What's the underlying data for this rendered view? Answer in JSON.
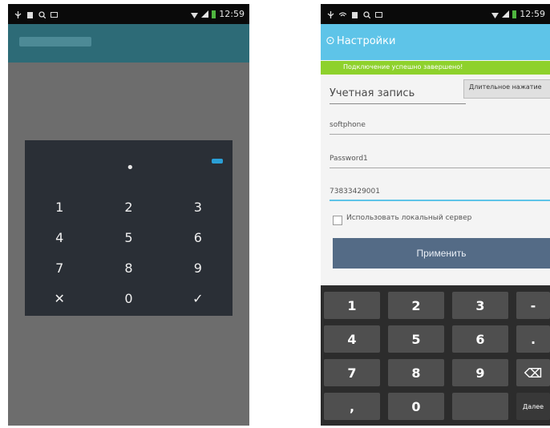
{
  "left_phone": {
    "status_time": "12:59",
    "dialog": {
      "entered_indicator": "•",
      "keys": [
        "1",
        "2",
        "3",
        "4",
        "5",
        "6",
        "7",
        "8",
        "9",
        "✕",
        "0",
        "✓"
      ]
    }
  },
  "right_phone": {
    "status_time": "12:59",
    "title": "Настройки",
    "back_symbol": "⊙",
    "notice": "Подключение успешно завершено!",
    "account_label": "Учетная запись",
    "tooltip": "Длительное нажатие",
    "fields": {
      "username": "softphone",
      "password": "Password1",
      "number": "73833429001"
    },
    "local_server_label": "Использовать локальный сервер",
    "apply_button": "Применить",
    "keyboard": {
      "row1": [
        "1",
        "2",
        "3",
        "-"
      ],
      "row2": [
        "4",
        "5",
        "6",
        "."
      ],
      "row3": [
        "7",
        "8",
        "9",
        "⌫"
      ],
      "row4": [
        ",",
        "0",
        "",
        "Далее"
      ]
    }
  },
  "colors": {
    "left_actionbar": "#2d6b77",
    "right_actionbar": "#5ec4e8",
    "notice_green": "#8ed12c",
    "apply_button": "#546b86",
    "ok_blue": "#2a9fd6"
  }
}
